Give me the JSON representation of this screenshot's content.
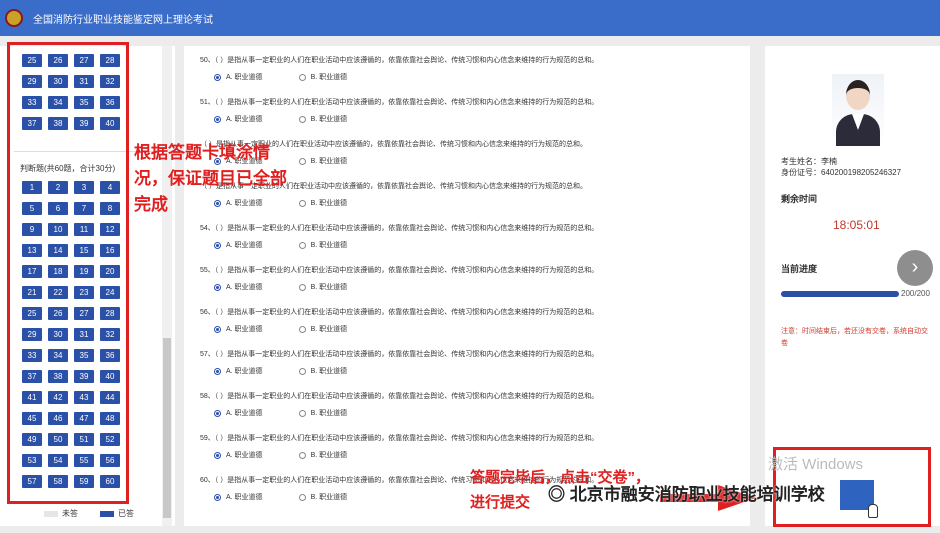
{
  "header": {
    "title": "全国消防行业职业技能鉴定网上理论考试"
  },
  "left_panel": {
    "top_numbers": [
      "25",
      "26",
      "27",
      "28",
      "29",
      "30",
      "31",
      "32",
      "33",
      "34",
      "35",
      "36",
      "37",
      "38",
      "39",
      "40"
    ],
    "judge_title": "判断题(共60题，合计30分)",
    "judge_numbers": [
      "1",
      "2",
      "3",
      "4",
      "5",
      "6",
      "7",
      "8",
      "9",
      "10",
      "11",
      "12",
      "13",
      "14",
      "15",
      "16",
      "17",
      "18",
      "19",
      "20",
      "21",
      "22",
      "23",
      "24",
      "25",
      "26",
      "27",
      "28",
      "29",
      "30",
      "31",
      "32",
      "33",
      "34",
      "35",
      "36",
      "37",
      "38",
      "39",
      "40",
      "41",
      "42",
      "43",
      "44",
      "45",
      "46",
      "47",
      "48",
      "49",
      "50",
      "51",
      "52",
      "53",
      "54",
      "55",
      "56",
      "57",
      "58",
      "59",
      "60"
    ],
    "legend_unanswered": "未答",
    "legend_answered": "已答"
  },
  "annotations": {
    "left_note": "根据答题卡填涂情况，保证题目已全部完成",
    "submit_note": "答题完毕后，点击“交卷”，进行提交"
  },
  "questions": [
    {
      "num": "50",
      "text": "50、（ ）是指从事一定职业的人们在职业活动中应该遵循的，依靠依靠社会舆论、传统习惯和内心信念来维持的行为规范的总和。",
      "opt_a": "A. 职业道德",
      "opt_b": "B. 职业道德"
    },
    {
      "num": "51",
      "text": "51、（ ）是指从事一定职业的人们在职业活动中应该遵循的，依靠依靠社会舆论、传统习惯和内心信念来维持的行为规范的总和。",
      "opt_a": "A. 职业道德",
      "opt_b": "B. 职业道德"
    },
    {
      "num": "52",
      "text": "（ ）是指从事一定职业的人们在职业活动中应该遵循的，依靠依靠社会舆论、传统习惯和内心信念来维持的行为规范的总和。",
      "opt_a": "A. 职业道德",
      "opt_b": "B. 职业道德"
    },
    {
      "num": "53",
      "text": "（ ）是指从事一定职业的人们在职业活动中应该遵循的，依靠依靠社会舆论、传统习惯和内心信念来维持的行为规范的总和。",
      "opt_a": "A. 职业道德",
      "opt_b": "B. 职业道德"
    },
    {
      "num": "54",
      "text": "54、（ ）是指从事一定职业的人们在职业活动中应该遵循的，依靠依靠社会舆论、传统习惯和内心信念来维持的行为规范的总和。",
      "opt_a": "A. 职业道德",
      "opt_b": "B. 职业道德"
    },
    {
      "num": "55",
      "text": "55、（ ）是指从事一定职业的人们在职业活动中应该遵循的，依靠依靠社会舆论、传统习惯和内心信念来维持的行为规范的总和。",
      "opt_a": "A. 职业道德",
      "opt_b": "B. 职业道德"
    },
    {
      "num": "56",
      "text": "56、（ ）是指从事一定职业的人们在职业活动中应该遵循的，依靠依靠社会舆论、传统习惯和内心信念来维持的行为规范的总和。",
      "opt_a": "A. 职业道德",
      "opt_b": "B. 职业道德"
    },
    {
      "num": "57",
      "text": "57、（ ）是指从事一定职业的人们在职业活动中应该遵循的，依靠依靠社会舆论、传统习惯和内心信念来维持的行为规范的总和。",
      "opt_a": "A. 职业道德",
      "opt_b": "B. 职业道德"
    },
    {
      "num": "58",
      "text": "58、（ ）是指从事一定职业的人们在职业活动中应该遵循的，依靠依靠社会舆论、传统习惯和内心信念来维持的行为规范的总和。",
      "opt_a": "A. 职业道德",
      "opt_b": "B. 职业道德"
    },
    {
      "num": "59",
      "text": "59、（ ）是指从事一定职业的人们在职业活动中应该遵循的，依靠依靠社会舆论、传统习惯和内心信念来维持的行为规范的总和。",
      "opt_a": "A. 职业道德",
      "opt_b": "B. 职业道德"
    },
    {
      "num": "60",
      "text": "60、（ ）是指从事一定职业的人们在职业活动中应该遵循的，依靠依靠社会舆论、传统习惯和内心信念来维持的行为规范的总和。",
      "opt_a": "A. 职业道德",
      "opt_b": "B. 职业道德"
    }
  ],
  "right_panel": {
    "name_line": "考生姓名：李楠",
    "id_line": "身份证号：640200198205246327",
    "remaining_label": "剩余时间",
    "remaining_time": "18:05:01",
    "progress_label": "当前进度",
    "progress_text": "200/200",
    "progress_fraction": 1.0,
    "note": "注意：时间结束后，若还没有交卷，系统自动交卷"
  },
  "overlay": {
    "activate_text": "激活 Windows",
    "watermark": "北京市融安消防职业技能培训学校"
  },
  "colors": {
    "header": "#3a6cc9",
    "answered": "#2b50a8",
    "highlight": "#e02020"
  }
}
